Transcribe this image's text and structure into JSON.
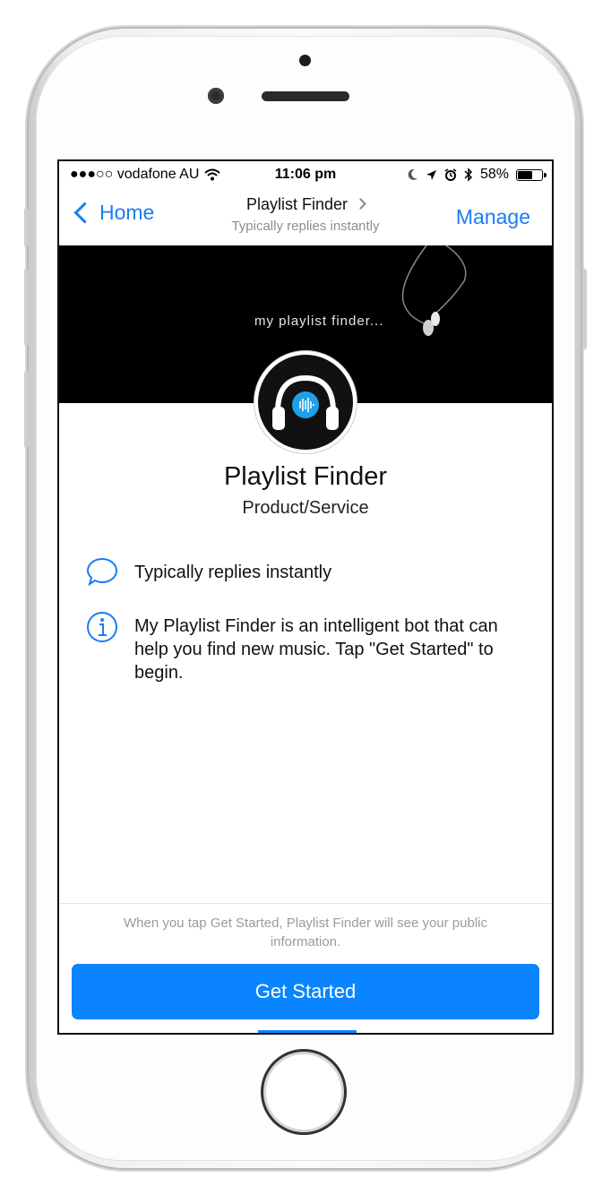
{
  "statusbar": {
    "carrier": "●●●○○ vodafone AU",
    "time": "11:06 pm",
    "battery": "58%",
    "battery_level": 0.58
  },
  "navbar": {
    "back_label": "Home",
    "title": "Playlist Finder",
    "subtitle": "Typically replies instantly",
    "manage_label": "Manage"
  },
  "cover": {
    "text": "my playlist finder..."
  },
  "profile": {
    "name": "Playlist Finder",
    "category": "Product/Service"
  },
  "info": {
    "reply_time": "Typically replies instantly",
    "about": "My Playlist Finder is an intelligent bot that can help you find new music. Tap \"Get Started\" to begin."
  },
  "footer": {
    "disclaimer": "When you tap Get Started, Playlist Finder will see your public information.",
    "cta_label": "Get Started"
  },
  "colors": {
    "accent": "#1a7cf5",
    "button": "#0a84ff",
    "cover": "#000000",
    "logo_accent": "#1da1e8"
  }
}
